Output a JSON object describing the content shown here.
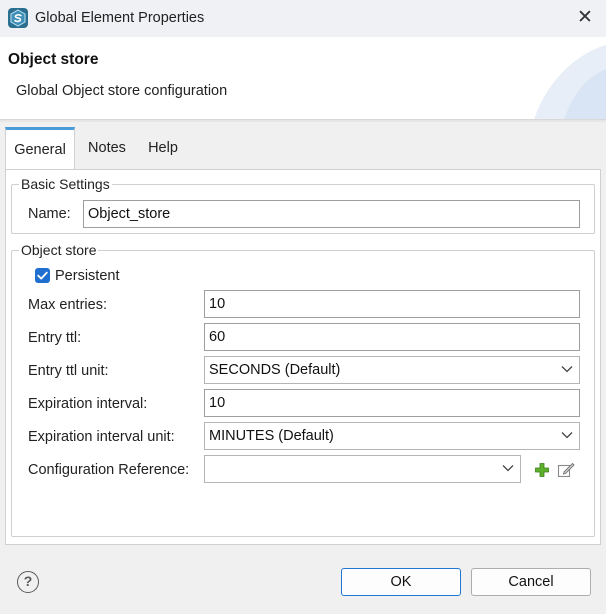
{
  "window": {
    "title": "Global Element Properties",
    "close_glyph": "✕"
  },
  "header": {
    "title": "Object store",
    "description": "Global Object store configuration"
  },
  "tabs": [
    {
      "label": "General",
      "active": true
    },
    {
      "label": "Notes",
      "active": false
    },
    {
      "label": "Help",
      "active": false
    }
  ],
  "basic_settings": {
    "legend": "Basic Settings",
    "name_label": "Name:",
    "name_value": "Object_store"
  },
  "object_store": {
    "legend": "Object store",
    "persistent_label": "Persistent",
    "persistent_checked": true,
    "max_entries_label": "Max entries:",
    "max_entries_value": "10",
    "entry_ttl_label": "Entry ttl:",
    "entry_ttl_value": "60",
    "entry_ttl_unit_label": "Entry ttl unit:",
    "entry_ttl_unit_value": "SECONDS (Default)",
    "expiration_interval_label": "Expiration interval:",
    "expiration_interval_value": "10",
    "expiration_interval_unit_label": "Expiration interval unit:",
    "expiration_interval_unit_value": "MINUTES (Default)",
    "config_ref_label": "Configuration Reference:",
    "config_ref_value": ""
  },
  "footer": {
    "help_glyph": "?",
    "ok_label": "OK",
    "cancel_label": "Cancel"
  },
  "colors": {
    "accent": "#1f77d6",
    "tab_indicator": "#4a9bd8",
    "add_icon": "#4caf2a",
    "app_icon": "#2a6f8f"
  },
  "icons": [
    "app-logo-icon",
    "close-icon",
    "chevron-down-icon",
    "add-icon",
    "edit-icon",
    "help-icon",
    "checkmark-icon"
  ]
}
